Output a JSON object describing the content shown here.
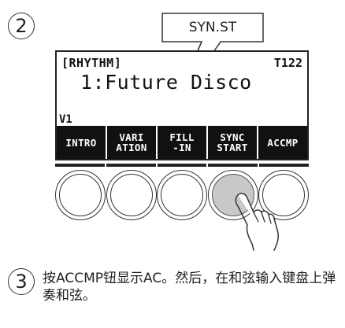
{
  "steps": {
    "step2_number": "②",
    "step3_number": "③",
    "step3_text": "按ACCMP钮显示AC。然后，在和弦输入键盘上弹奏和弦。"
  },
  "callout": {
    "label": "SYN.ST"
  },
  "lcd": {
    "header_left": "[RHYTHM]",
    "header_right": "T122",
    "tone_line": "1:Future Disco",
    "variation": "V1",
    "softkeys": [
      {
        "label": "INTRO"
      },
      {
        "label": "VARI\nATION"
      },
      {
        "label": "FILL\n-IN"
      },
      {
        "label": "SYNC\nSTART"
      },
      {
        "label": "ACCMP"
      }
    ]
  },
  "knobs": {
    "pressed_index": 3,
    "names": [
      "intro-knob",
      "variation-knob",
      "fill-in-knob",
      "sync-start-knob",
      "accmp-knob"
    ]
  },
  "icons": {
    "hand": "pointing-hand-icon"
  }
}
